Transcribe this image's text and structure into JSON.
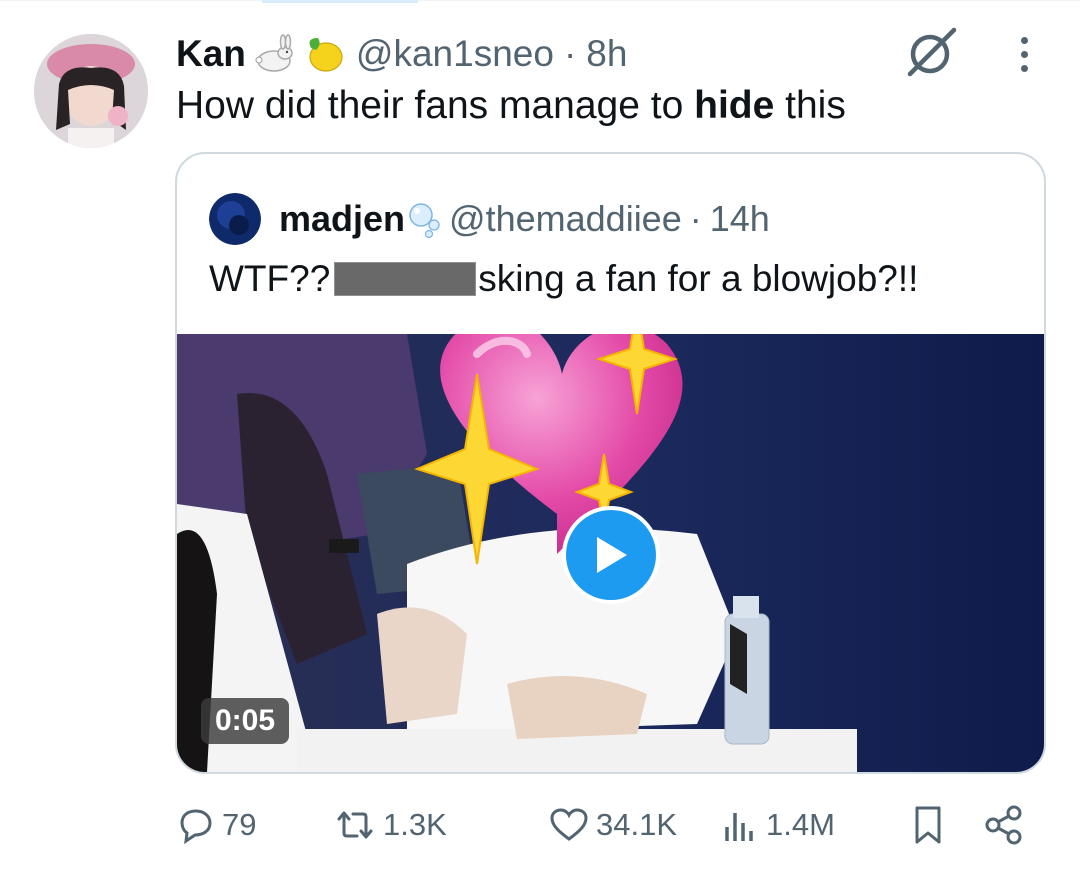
{
  "tweet": {
    "author_name": "Kan",
    "author_emojis": [
      "rabbit-icon",
      "lemon-icon"
    ],
    "handle": "@kan1sneo",
    "separator": "·",
    "time": "8h",
    "text_before": "How did their fans manage to ",
    "text_bold": "hide",
    "text_after": " this"
  },
  "quote": {
    "author_name": "madjen",
    "author_emoji": "bubbles-icon",
    "handle": "@themaddiiee",
    "separator": "·",
    "time": "14h",
    "text_before": "WTF?? ",
    "text_after": "sking a fan for a blowjob?!!",
    "video_duration": "0:05"
  },
  "actions": {
    "replies": "79",
    "reposts": "1.3K",
    "likes": "34.1K",
    "views": "1.4M"
  },
  "colors": {
    "accent": "#1d9bf0",
    "secondary_text": "#536471",
    "border": "#cfd9de"
  }
}
